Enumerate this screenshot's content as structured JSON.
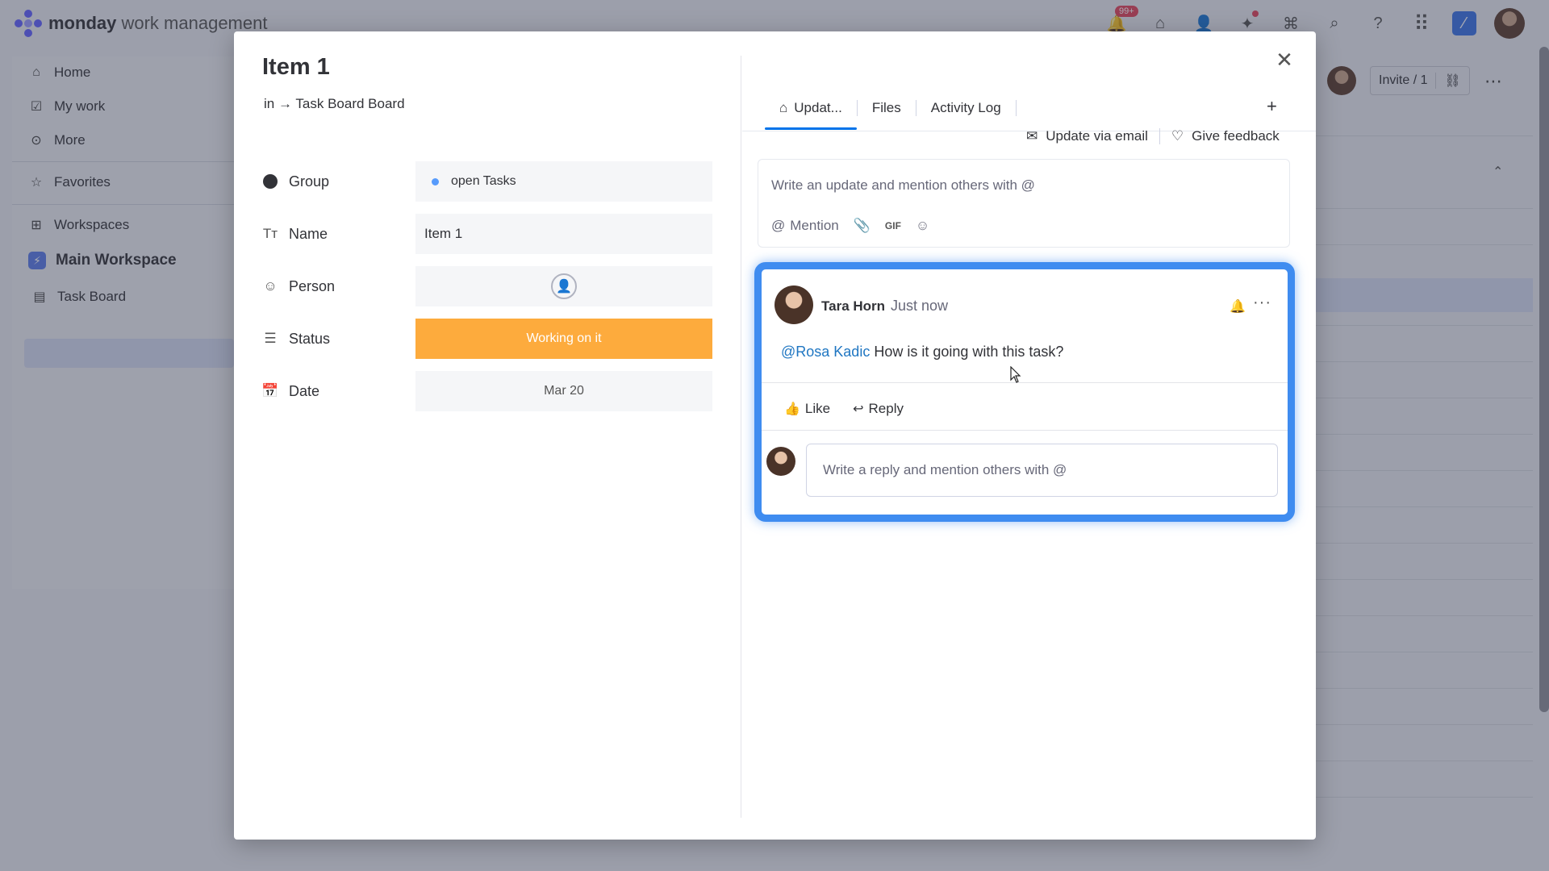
{
  "app": {
    "brand": "monday",
    "brand_suffix": "work management",
    "notification_count": "99+"
  },
  "sidebar": {
    "items": [
      {
        "label": "Home",
        "icon": "home-icon"
      },
      {
        "label": "My work",
        "icon": "calendar-check-icon"
      },
      {
        "label": "More",
        "icon": "more-circle-icon"
      },
      {
        "label": "Favorites",
        "icon": "star-icon"
      },
      {
        "label": "Workspaces",
        "icon": "grid-icon"
      },
      {
        "label": "Main Workspace",
        "icon": "workspace-icon"
      },
      {
        "label": "Task Board",
        "icon": "board-icon"
      }
    ]
  },
  "board_header": {
    "invite_label": "Invite / 1"
  },
  "modal": {
    "title": "Item 1",
    "breadcrumb_prefix": "in →",
    "breadcrumb_board": "Task Board Board",
    "fields": [
      {
        "label": "Group",
        "value": "open Tasks"
      },
      {
        "label": "Name",
        "value": "Item 1"
      },
      {
        "label": "Person",
        "value": ""
      },
      {
        "label": "Status",
        "value": "Working on it"
      },
      {
        "label": "Date",
        "value": "Mar 20"
      }
    ],
    "tabs": [
      {
        "label": "Updat...",
        "active": true
      },
      {
        "label": "Files",
        "active": false
      },
      {
        "label": "Activity Log",
        "active": false
      }
    ],
    "tab_add": "+",
    "update_via_email": "Update via email",
    "give_feedback": "Give feedback",
    "update_placeholder": "Write an update and mention others with @",
    "tools": {
      "mention": "Mention",
      "gif": "GIF"
    },
    "post": {
      "author": "Tara Horn",
      "time": "Just now",
      "mention": "@Rosa Kadic",
      "text": " How is it going with this task?",
      "like": "Like",
      "reply": "Reply",
      "reply_placeholder": "Write a reply and mention others with @"
    }
  },
  "colors": {
    "status_working": "#fdab3d",
    "accent": "#0073ea",
    "highlight_border": "#3f8cf0",
    "mention": "#1f76c2",
    "group_dot": "#579bfc"
  }
}
